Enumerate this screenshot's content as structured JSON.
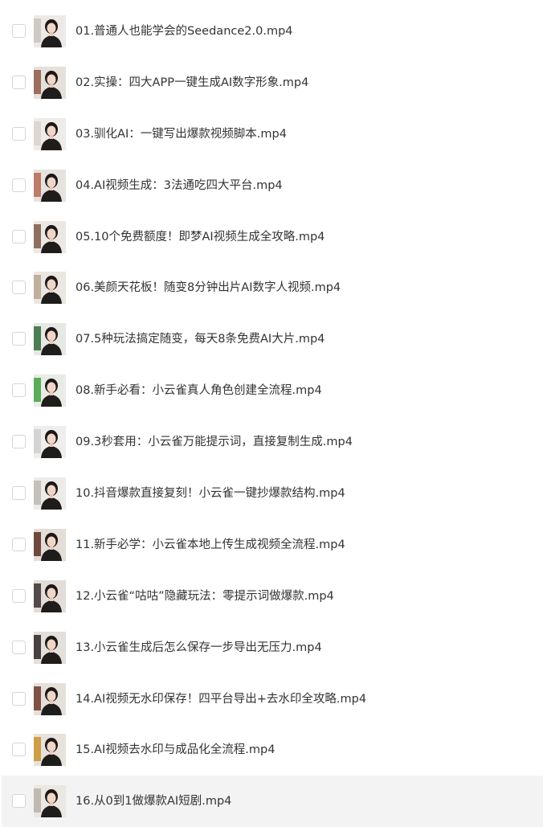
{
  "files": [
    {
      "name": "01.普通人也能学会的Seedance2.0.mp4",
      "thumb_bg": "#ece9e6",
      "thumb_accent": "#c9c3bd"
    },
    {
      "name": "02.实操：四大APP一键生成AI数字形象.mp4",
      "thumb_bg": "#e6e0da",
      "thumb_accent": "#8d5a46"
    },
    {
      "name": "03.驯化AI：一键写出爆款视频脚本.mp4",
      "thumb_bg": "#eeebe8",
      "thumb_accent": "#d9d3cd"
    },
    {
      "name": "04.AI视频生成：3法通吃四大平台.mp4",
      "thumb_bg": "#e7e2dd",
      "thumb_accent": "#b56a52"
    },
    {
      "name": "05.10个免费额度！即梦AI视频生成全攻略.mp4",
      "thumb_bg": "#ece7e2",
      "thumb_accent": "#7d5a4a"
    },
    {
      "name": "06.美颜天花板！随变8分钟出片AI数字人视频.mp4",
      "thumb_bg": "#ebe6e1",
      "thumb_accent": "#b9a590"
    },
    {
      "name": "07.5种玩法搞定随变，每天8条免费AI大片.mp4",
      "thumb_bg": "#e6e8e4",
      "thumb_accent": "#2f6b3c"
    },
    {
      "name": "08.新手必看：小云雀真人角色创建全流程.mp4",
      "thumb_bg": "#e9ebe6",
      "thumb_accent": "#3fa23e"
    },
    {
      "name": "09.3秒套用：小云雀万能提示词，直接复制生成.mp4",
      "thumb_bg": "#eeeeec",
      "thumb_accent": "#cfcfcf"
    },
    {
      "name": "10.抖音爆款直接复刻！小云雀一键抄爆款结构.mp4",
      "thumb_bg": "#ecebe8",
      "thumb_accent": "#bdb8b2"
    },
    {
      "name": "11.新手必学：小云雀本地上传生成视频全流程.mp4",
      "thumb_bg": "#e4ddd7",
      "thumb_accent": "#5a2e24"
    },
    {
      "name": "12.小云雀“咕咕”隐藏玩法：零提示词做爆款.mp4",
      "thumb_bg": "#e2ddd8",
      "thumb_accent": "#3a3030"
    },
    {
      "name": "13.小云雀生成后怎么保存一步导出无压力.mp4",
      "thumb_bg": "#e3dfda",
      "thumb_accent": "#2b2626"
    },
    {
      "name": "14.AI视频无水印保存！四平台导出+去水印全攻略.mp4",
      "thumb_bg": "#e6e0da",
      "thumb_accent": "#6b3a2c"
    },
    {
      "name": "15.AI视频去水印与成品化全流程.mp4",
      "thumb_bg": "#e8e2dc",
      "thumb_accent": "#c8922e"
    },
    {
      "name": "16.从0到1做爆款AI短剧.mp4",
      "thumb_bg": "#ebe7e3",
      "thumb_accent": "#b9b1aa"
    }
  ],
  "highlighted_index": 15
}
